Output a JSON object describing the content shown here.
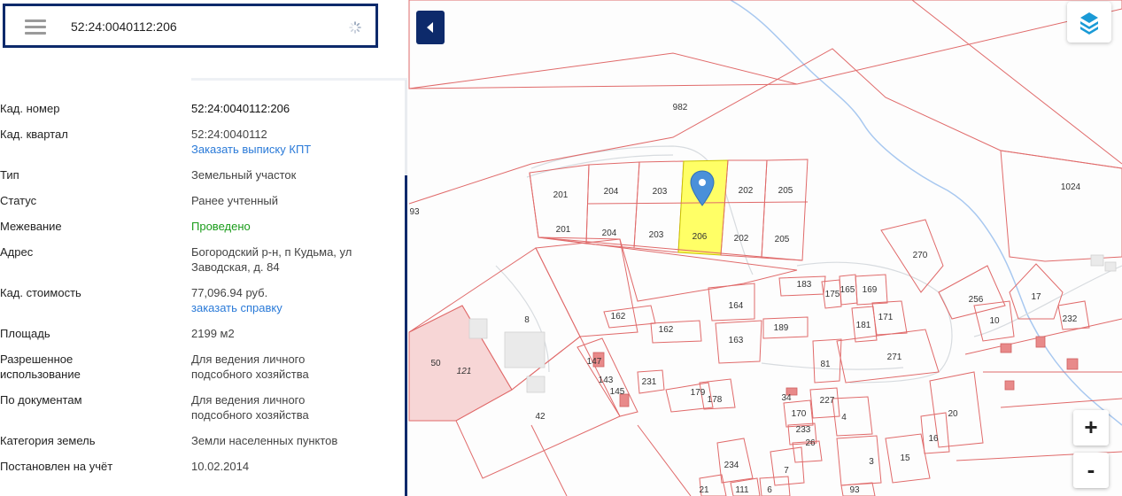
{
  "search": {
    "value": "52:24:0040112:206"
  },
  "details": [
    {
      "label": "Кад. номер",
      "value": "52:24:0040112:206",
      "style": "strong"
    },
    {
      "label": "Кад. квартал",
      "value": "52:24:0040112",
      "link": "Заказать выписку КПТ"
    },
    {
      "label": "Тип",
      "value": "Земельный участок"
    },
    {
      "label": "Статус",
      "value": "Ранее учтенный"
    },
    {
      "label": "Межевание",
      "value": "Проведено",
      "style": "green"
    },
    {
      "label": "Адрес",
      "value": "Богородский р-н, п Кудьма, ул Заводская, д. 84"
    },
    {
      "label": "Кад. стоимость",
      "value": "77,096.94 руб.",
      "link": "заказать справку"
    },
    {
      "label": "Площадь",
      "value": "2199 м2"
    },
    {
      "label": "Разрешенное использование",
      "value": "Для ведения личного подсобного хозяйства"
    },
    {
      "label": "По документам",
      "value": "Для ведения личного подсобного хозяйства"
    },
    {
      "label": "Категория земель",
      "value": "Земли населенных пунктов"
    },
    {
      "label": "Постановлен на учёт",
      "value": "10.02.2014"
    }
  ],
  "map": {
    "plot_labels": [
      "982",
      "1024",
      "93",
      "201",
      "204",
      "203",
      "206",
      "202",
      "205",
      "270",
      "256",
      "17",
      "10",
      "232",
      "183",
      "175",
      "165",
      "169",
      "171",
      "181",
      "162",
      "164",
      "163",
      "189",
      "8",
      "50",
      "121",
      "42",
      "147",
      "143",
      "145",
      "231",
      "179",
      "178",
      "81",
      "271",
      "34",
      "227",
      "170",
      "233",
      "26",
      "4",
      "20",
      "16",
      "3",
      "15",
      "234",
      "111",
      "6",
      "7",
      "93",
      "21"
    ],
    "selected_plot": "206",
    "colors": {
      "boundary": "#e06a6a",
      "selected_fill": "#ffff66",
      "river": "#a8c8f0",
      "marker": "#4a90d9",
      "brand": "#0d2a6b"
    }
  },
  "controls": {
    "zoom_in": "+",
    "zoom_out": "-"
  }
}
